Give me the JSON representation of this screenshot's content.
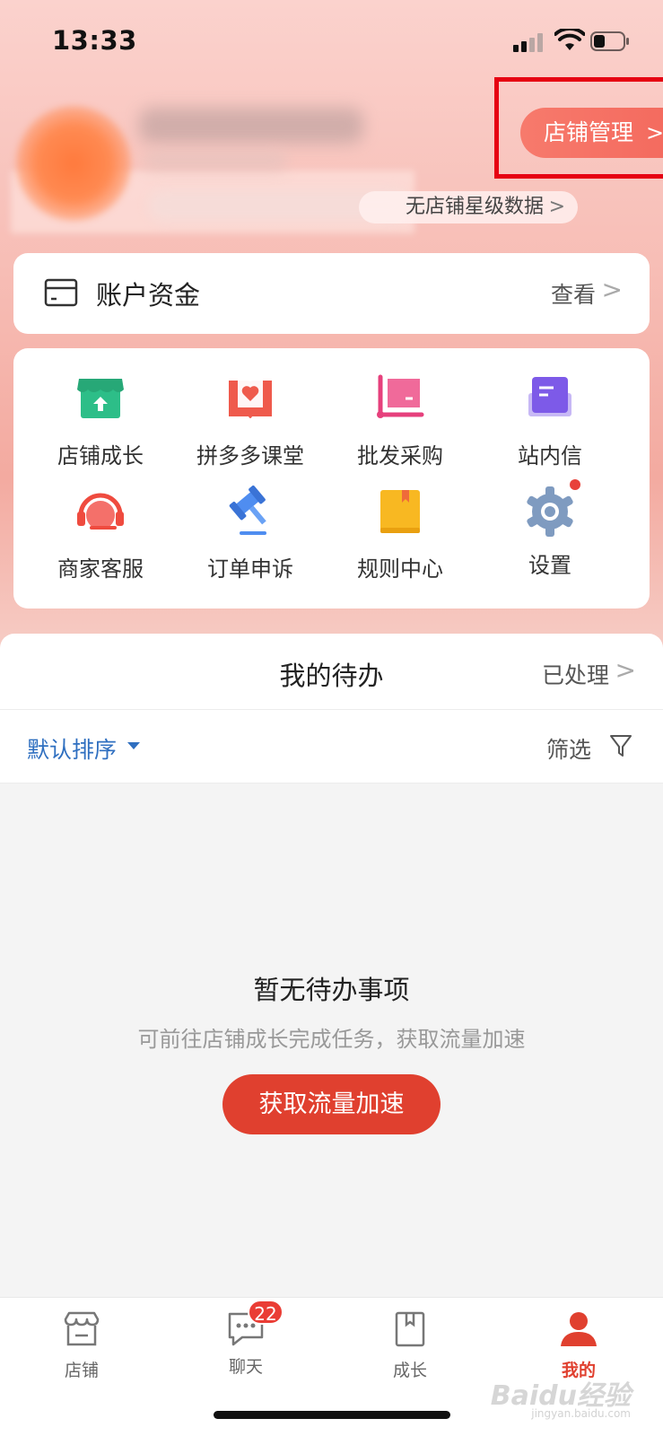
{
  "status_bar": {
    "time": "13:33"
  },
  "profile": {
    "store_manage_label": "店铺管理",
    "rating_label": "无店铺星级数据"
  },
  "fund": {
    "title": "账户资金",
    "view_label": "查看"
  },
  "grid": {
    "items": [
      {
        "label": "店铺成长",
        "icon": "store-growth-icon"
      },
      {
        "label": "拼多多课堂",
        "icon": "book-heart-icon"
      },
      {
        "label": "批发采购",
        "icon": "cart-icon"
      },
      {
        "label": "站内信",
        "icon": "mail-icon"
      },
      {
        "label": "商家客服",
        "icon": "headset-icon"
      },
      {
        "label": "订单申诉",
        "icon": "gavel-icon"
      },
      {
        "label": "规则中心",
        "icon": "rule-book-icon"
      },
      {
        "label": "设置",
        "icon": "gear-icon"
      }
    ]
  },
  "todo": {
    "title": "我的待办",
    "done_label": "已处理",
    "sort_label": "默认排序",
    "filter_label": "筛选",
    "empty_title": "暂无待办事项",
    "empty_subtitle": "可前往店铺成长完成任务，获取流量加速",
    "cta_label": "获取流量加速"
  },
  "tabs": [
    {
      "label": "店铺",
      "icon": "store-icon"
    },
    {
      "label": "聊天",
      "icon": "chat-icon",
      "badge": "22"
    },
    {
      "label": "成长",
      "icon": "bookmark-icon"
    },
    {
      "label": "我的",
      "icon": "person-icon",
      "active": true
    }
  ],
  "watermark": {
    "text": "Baidu经验",
    "sub": "jingyan.baidu.com"
  },
  "colors": {
    "accent": "#e0402f",
    "link_blue": "#2f6fc0",
    "highlight_frame": "#e60012"
  }
}
